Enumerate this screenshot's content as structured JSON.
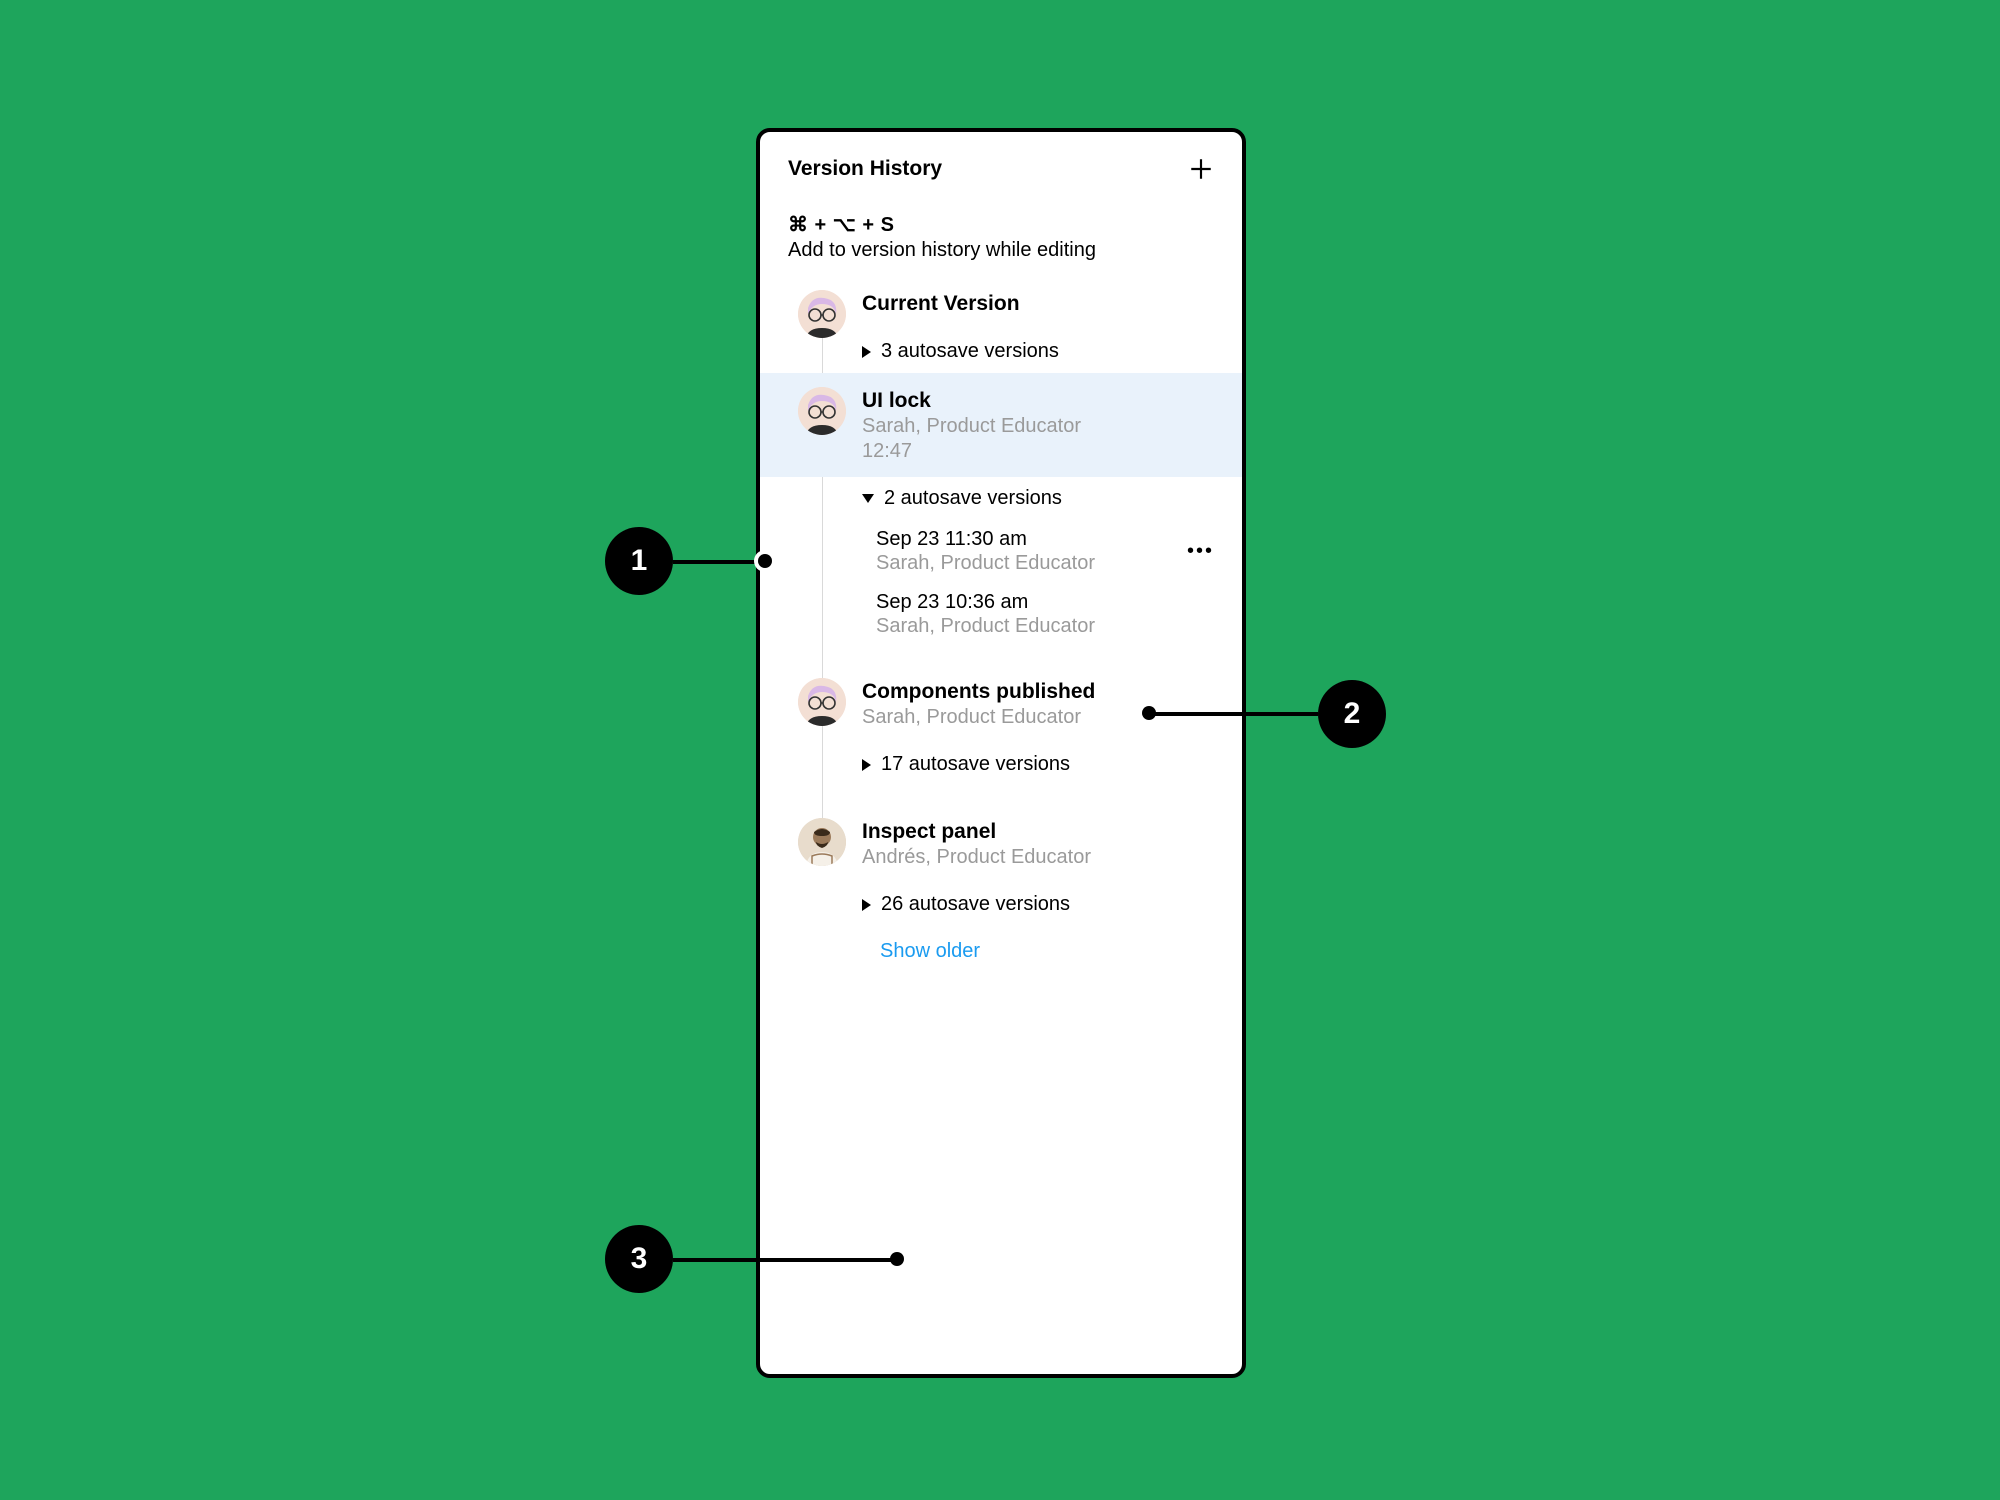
{
  "header": {
    "title": "Version History"
  },
  "shortcut": {
    "keys": "⌘ + ⌥ + S",
    "description": "Add to version history while editing"
  },
  "current": {
    "title": "Current Version",
    "autosave_label": "3 autosave versions"
  },
  "ui_lock": {
    "title": "UI lock",
    "author": "Sarah, Product Educator",
    "time": "12:47",
    "autosave_label": "2 autosave versions",
    "sub1_time": "Sep 23 11:30 am",
    "sub1_author": "Sarah, Product Educator",
    "sub2_time": "Sep 23 10:36 am",
    "sub2_author": "Sarah, Product Educator"
  },
  "components_published": {
    "title": "Components published",
    "author": "Sarah, Product Educator",
    "autosave_label": "17 autosave versions"
  },
  "inspect_panel": {
    "title": "Inspect panel",
    "author": "Andrés, Product Educator",
    "autosave_label": "26 autosave versions"
  },
  "show_older_label": "Show older",
  "callouts": {
    "one": "1",
    "two": "2",
    "three": "3"
  }
}
